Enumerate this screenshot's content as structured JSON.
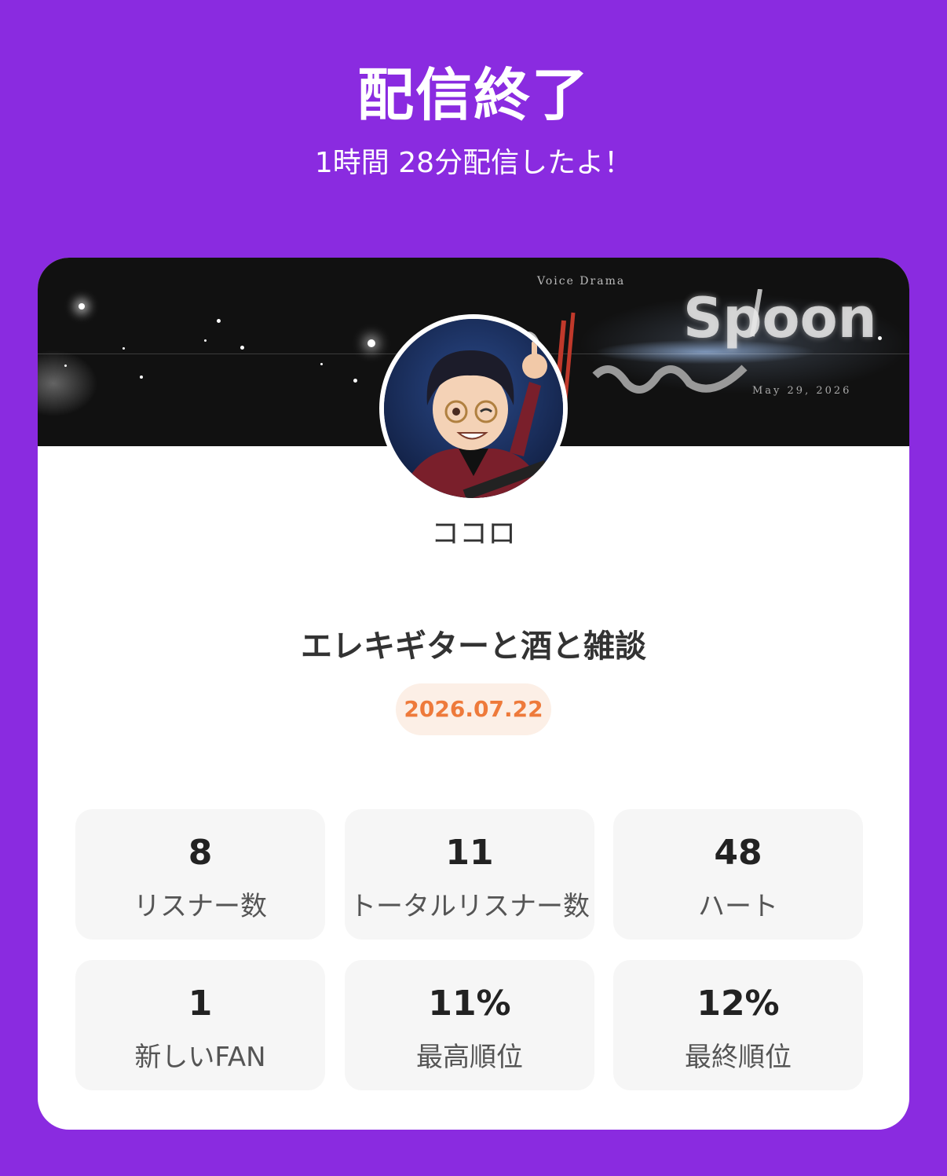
{
  "header": {
    "title": "配信終了",
    "subtitle": "1時間 28分配信したよ！"
  },
  "banner": {
    "small_text": "Voice Drama",
    "logo_text": "Spoon",
    "date_text": "May 29, 2026"
  },
  "profile": {
    "name": "ココロ"
  },
  "stream": {
    "title": "エレキギターと酒と雑談",
    "date": "2026.07.22"
  },
  "stats": [
    {
      "value": "8",
      "label": "リスナー数"
    },
    {
      "value": "11",
      "label": "トータルリスナー数"
    },
    {
      "value": "48",
      "label": "ハート"
    },
    {
      "value": "1",
      "label": "新しいFAN"
    },
    {
      "value": "11%",
      "label": "最高順位"
    },
    {
      "value": "12%",
      "label": "最終順位"
    }
  ],
  "colors": {
    "background": "#8a2be0",
    "date_badge_bg": "#fcefe6",
    "date_badge_text": "#ee7a3b"
  }
}
